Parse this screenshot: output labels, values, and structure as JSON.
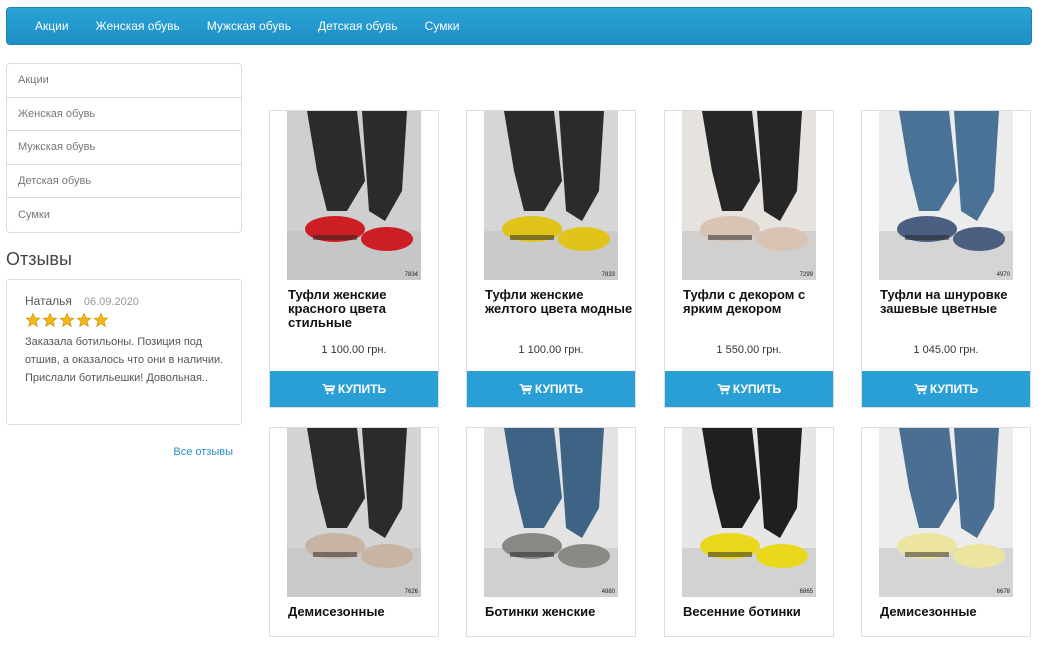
{
  "topnav": {
    "items": [
      "Акции",
      "Женская обувь",
      "Мужская обувь",
      "Детская обувь",
      "Сумки"
    ]
  },
  "sidebar": {
    "items": [
      "Акции",
      "Женская обувь",
      "Мужская обувь",
      "Детская обувь",
      "Сумки"
    ]
  },
  "reviews": {
    "title": "Отзывы",
    "name": "Наталья",
    "date": "06.09.2020",
    "rating": 5,
    "text": "Заказала ботильоны. Позиция под отшив, а оказалось что они в наличии. Прислали ботильешки! Довольная..",
    "all_link": "Все отзывы"
  },
  "buy_label": "КУПИТЬ",
  "products": [
    {
      "name": "Туфли женские красного цвета стильные",
      "price": "1 100.00 грн.",
      "code": "7834",
      "shoe_color": "#cc1f24",
      "bg": "#cfcfcf",
      "trouser": "#2b2b2b"
    },
    {
      "name": "Туфли женские желтого цвета модные",
      "price": "1 100.00 грн.",
      "code": "7833",
      "shoe_color": "#e0c419",
      "bg": "#d6d6d6",
      "trouser": "#2b2b2b"
    },
    {
      "name": "Туфли с декором с ярким декором",
      "price": "1 550.00 грн.",
      "code": "7299",
      "shoe_color": "#d9c4b4",
      "bg": "#e6e3df",
      "trouser": "#262626"
    },
    {
      "name": "Туфли на шнуровке зашевые цветные",
      "price": "1 045.00 грн.",
      "code": "4970",
      "shoe_color": "#4b5f80",
      "bg": "#ececec",
      "trouser": "#4a7296"
    },
    {
      "name": "Демисезонные",
      "price": "",
      "code": "7626",
      "shoe_color": "#c8b4a3",
      "bg": "#d4d4d4",
      "trouser": "#2b2b2b"
    },
    {
      "name": "Ботинки женские",
      "price": "",
      "code": "4880",
      "shoe_color": "#8a8986",
      "bg": "#e3e3e3",
      "trouser": "#3f6385"
    },
    {
      "name": "Весенние ботинки",
      "price": "",
      "code": "6865",
      "shoe_color": "#e9d81b",
      "bg": "#e6e6e6",
      "trouser": "#1f1f1f"
    },
    {
      "name": "Демисезонные",
      "price": "",
      "code": "6678",
      "shoe_color": "#ece5a0",
      "bg": "#ececec",
      "trouser": "#4a6f93"
    }
  ]
}
